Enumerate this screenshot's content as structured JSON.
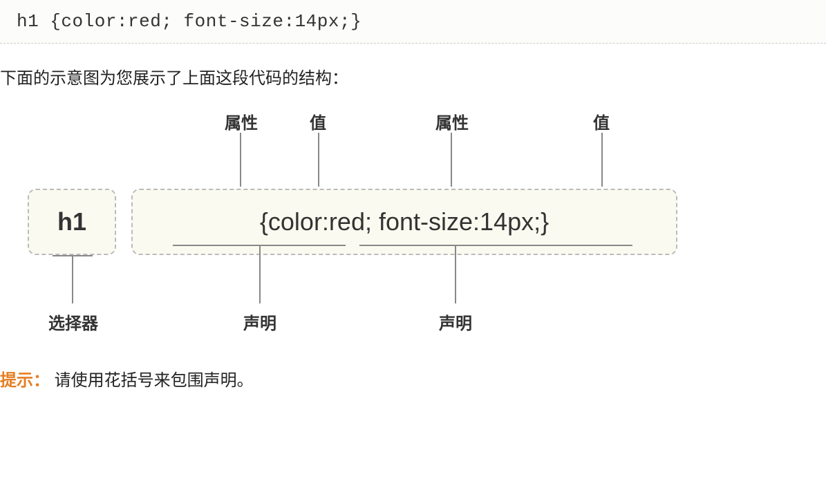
{
  "code": "h1 {color:red; font-size:14px;}",
  "description": "下面的示意图为您展示了上面这段代码的结构：",
  "labels": {
    "property1": "属性",
    "value1": "值",
    "property2": "属性",
    "value2": "值",
    "selector": "选择器",
    "declaration1": "声明",
    "declaration2": "声明"
  },
  "diagram": {
    "selector_text": "h1",
    "decl_text": "{color:red; font-size:14px;}"
  },
  "tip_label": "提示：",
  "tip_text": "请使用花括号来包围声明。"
}
